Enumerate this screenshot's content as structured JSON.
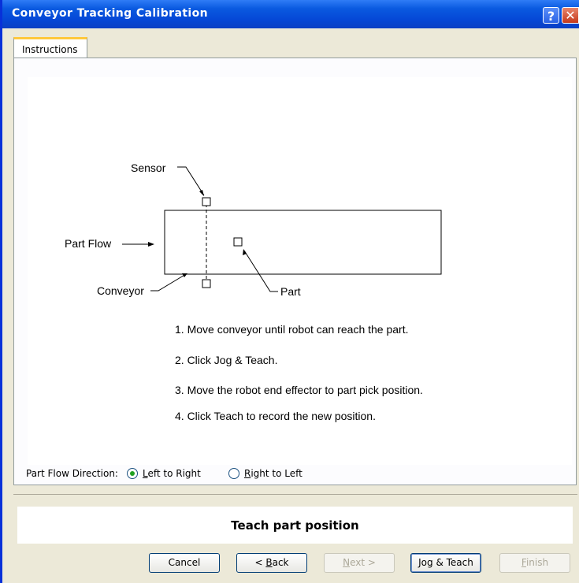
{
  "window": {
    "title": "Conveyor Tracking Calibration",
    "help_glyph": "?",
    "close_glyph": "✕"
  },
  "tabs": [
    {
      "label": "Instructions"
    }
  ],
  "diagram": {
    "sensor_label": "Sensor",
    "part_flow_label": "Part Flow",
    "conveyor_label": "Conveyor",
    "part_label": "Part"
  },
  "instructions": [
    "1. Move conveyor until robot can reach the part.",
    "2. Click Jog & Teach.",
    "3. Move the robot end effector to part pick position.",
    "4. Click Teach to record the new position."
  ],
  "flow_direction": {
    "label": "Part Flow Direction:",
    "options": [
      {
        "mnemonic": "L",
        "rest": "eft to Right",
        "selected": true
      },
      {
        "mnemonic": "R",
        "rest": "ight to Left",
        "selected": false
      }
    ]
  },
  "status_text": "Teach part position",
  "buttons": {
    "cancel": "Cancel",
    "back": {
      "prefix": "< ",
      "mnemonic": "B",
      "rest": "ack"
    },
    "next": {
      "mnemonic": "N",
      "rest": "ext >"
    },
    "jog_teach": "Jog & Teach",
    "finish": {
      "mnemonic": "F",
      "rest": "inish"
    }
  }
}
